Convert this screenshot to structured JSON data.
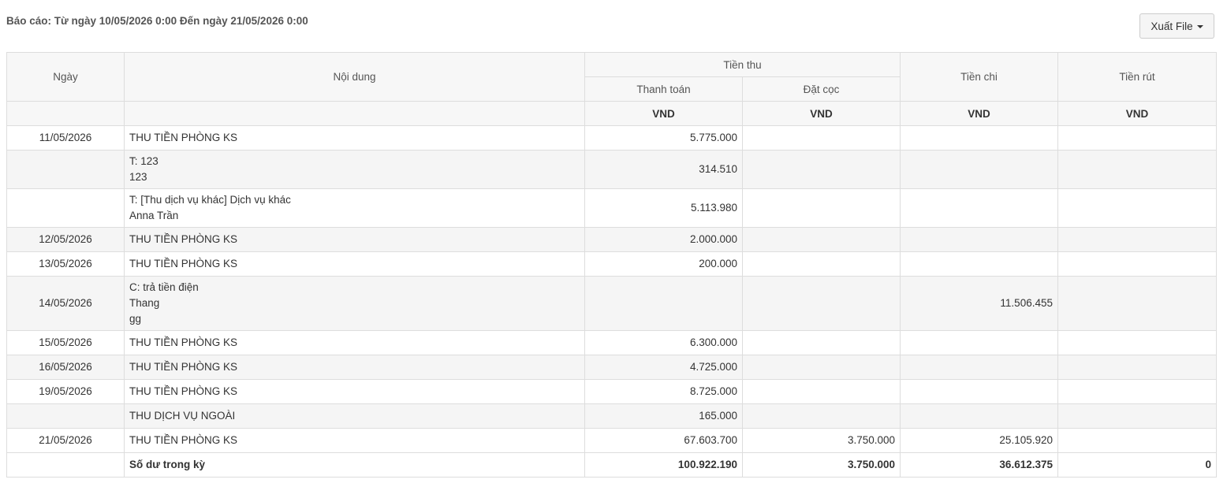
{
  "report": {
    "title": "Báo cáo: Từ ngày 10/05/2026 0:00 Đến ngày 21/05/2026 0:00",
    "export_label": "Xuất File"
  },
  "table": {
    "headers": {
      "date": "Ngày",
      "content": "Nội dung",
      "income": "Tiền thu",
      "payment": "Thanh toán",
      "deposit": "Đặt cọc",
      "expense": "Tiền chi",
      "withdraw": "Tiền rút"
    },
    "units": {
      "payment": "VND",
      "deposit": "VND",
      "expense": "VND",
      "withdraw": "VND"
    },
    "rows": [
      {
        "date": "11/05/2026",
        "content": [
          "THU TIỀN PHÒNG KS"
        ],
        "payment": "5.775.000",
        "deposit": "",
        "expense": "",
        "withdraw": ""
      },
      {
        "date": "",
        "content": [
          "T: 123",
          "123"
        ],
        "payment": "314.510",
        "deposit": "",
        "expense": "",
        "withdraw": ""
      },
      {
        "date": "",
        "content": [
          "T: [Thu dịch vụ khác] Dịch vụ khác",
          "Anna Trần"
        ],
        "payment": "5.113.980",
        "deposit": "",
        "expense": "",
        "withdraw": ""
      },
      {
        "date": "12/05/2026",
        "content": [
          "THU TIỀN PHÒNG KS"
        ],
        "payment": "2.000.000",
        "deposit": "",
        "expense": "",
        "withdraw": ""
      },
      {
        "date": "13/05/2026",
        "content": [
          "THU TIỀN PHÒNG KS"
        ],
        "payment": "200.000",
        "deposit": "",
        "expense": "",
        "withdraw": ""
      },
      {
        "date": "14/05/2026",
        "content": [
          "C: trả tiền điện",
          "Thang",
          "gg"
        ],
        "payment": "",
        "deposit": "",
        "expense": "11.506.455",
        "withdraw": ""
      },
      {
        "date": "15/05/2026",
        "content": [
          "THU TIỀN PHÒNG KS"
        ],
        "payment": "6.300.000",
        "deposit": "",
        "expense": "",
        "withdraw": ""
      },
      {
        "date": "16/05/2026",
        "content": [
          "THU TIỀN PHÒNG KS"
        ],
        "payment": "4.725.000",
        "deposit": "",
        "expense": "",
        "withdraw": ""
      },
      {
        "date": "19/05/2026",
        "content": [
          "THU TIỀN PHÒNG KS"
        ],
        "payment": "8.725.000",
        "deposit": "",
        "expense": "",
        "withdraw": ""
      },
      {
        "date": "",
        "content": [
          "THU DỊCH VỤ NGOÀI"
        ],
        "payment": "165.000",
        "deposit": "",
        "expense": "",
        "withdraw": ""
      },
      {
        "date": "21/05/2026",
        "content": [
          "THU TIỀN PHÒNG KS"
        ],
        "payment": "67.603.700",
        "deposit": "3.750.000",
        "expense": "25.105.920",
        "withdraw": ""
      }
    ],
    "total": {
      "label": "Số dư trong kỳ",
      "payment": "100.922.190",
      "deposit": "3.750.000",
      "expense": "36.612.375",
      "withdraw": "0"
    }
  }
}
